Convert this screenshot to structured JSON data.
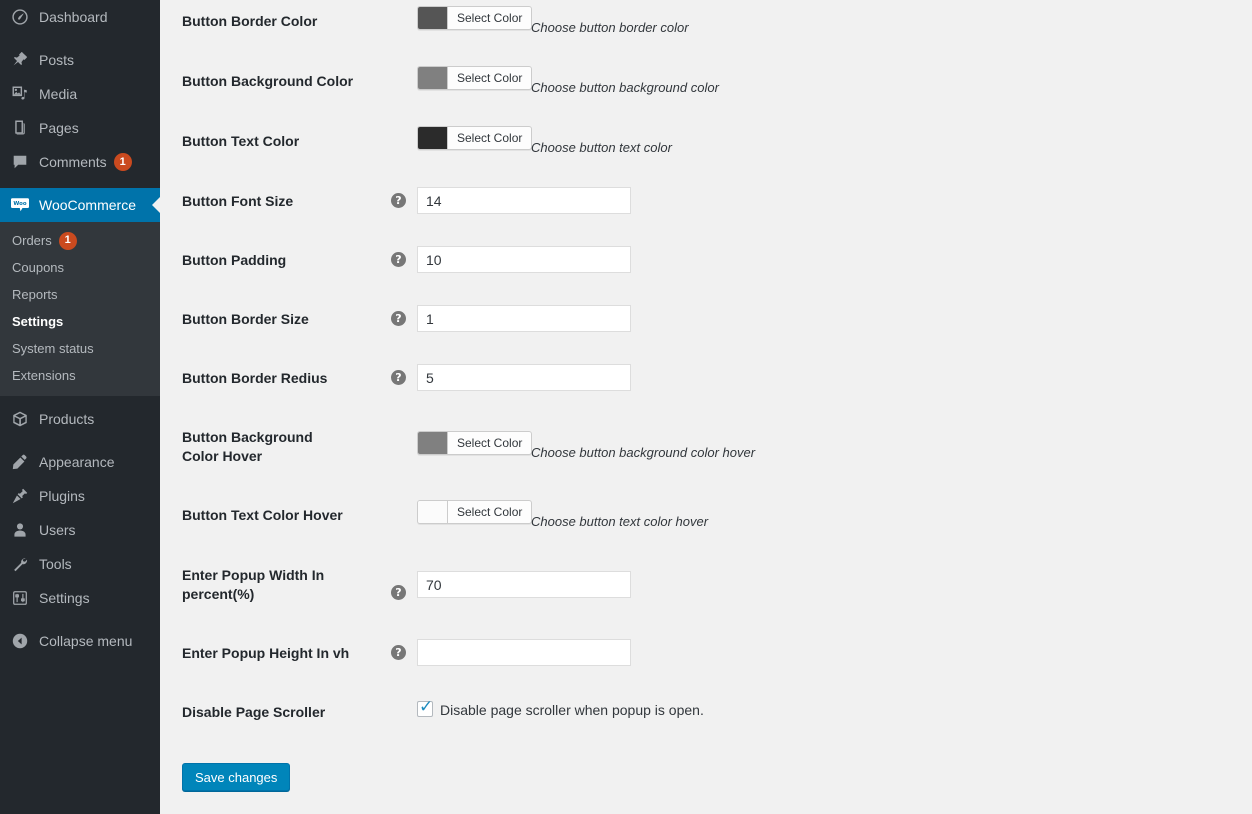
{
  "sidebar": {
    "items": [
      {
        "label": "Dashboard",
        "icon": "dashboard-icon",
        "gap_before": false
      },
      {
        "label": "Posts",
        "icon": "pin-icon",
        "gap_before": true
      },
      {
        "label": "Media",
        "icon": "media-icon",
        "gap_before": false
      },
      {
        "label": "Pages",
        "icon": "pages-icon",
        "gap_before": false
      },
      {
        "label": "Comments",
        "icon": "comment-icon",
        "badge": "1",
        "gap_before": false
      },
      {
        "label": "WooCommerce",
        "icon": "woo-icon",
        "current": true,
        "gap_before": true
      },
      {
        "label": "Products",
        "icon": "products-icon",
        "gap_before": false
      },
      {
        "label": "Appearance",
        "icon": "appearance-icon",
        "gap_before": true
      },
      {
        "label": "Plugins",
        "icon": "plugins-icon",
        "gap_before": false
      },
      {
        "label": "Users",
        "icon": "users-icon",
        "gap_before": false
      },
      {
        "label": "Tools",
        "icon": "tools-icon",
        "gap_before": false
      },
      {
        "label": "Settings",
        "icon": "settings-icon",
        "gap_before": false
      },
      {
        "label": "Collapse menu",
        "icon": "collapse-icon",
        "gap_before": true
      }
    ],
    "submenu": [
      {
        "label": "Orders",
        "badge": "1"
      },
      {
        "label": "Coupons"
      },
      {
        "label": "Reports"
      },
      {
        "label": "Settings",
        "current": true
      },
      {
        "label": "System status"
      },
      {
        "label": "Extensions"
      }
    ],
    "colors": {
      "background": "#23282d",
      "submenu_background": "#32373c",
      "current_background": "#0073aa",
      "badge": "#ca4a1f",
      "text": "#b4b9be"
    }
  },
  "settings": {
    "select_color_label": "Select Color",
    "rows": [
      {
        "label": "Button Border Color",
        "type": "color",
        "swatch": "#555555",
        "description": "Choose button border color"
      },
      {
        "label": "Button Background Color",
        "type": "color",
        "swatch": "#808080",
        "description": "Choose button background color"
      },
      {
        "label": "Button Text Color",
        "type": "color",
        "swatch": "#2b2b2b",
        "description": "Choose button text color"
      },
      {
        "label": "Button Font Size",
        "type": "text",
        "value": "14",
        "help": "?"
      },
      {
        "label": "Button Padding",
        "type": "text",
        "value": "10",
        "help": "?"
      },
      {
        "label": "Button Border Size",
        "type": "text",
        "value": "1",
        "help": "?"
      },
      {
        "label": "Button Border Redius",
        "type": "text",
        "value": "5",
        "help": "?"
      },
      {
        "label": "Button Background Color Hover",
        "type": "color",
        "swatch": "#808080",
        "description": "Choose button background color hover"
      },
      {
        "label": "Button Text Color Hover",
        "type": "color",
        "swatch": "#fbfbfb",
        "description": "Choose button text color hover"
      },
      {
        "label": "Enter Popup Width In percent(%)",
        "type": "text",
        "value": "70",
        "help": "?"
      },
      {
        "label": "Enter Popup Height In vh",
        "type": "text",
        "value": "",
        "help": "?"
      },
      {
        "label": "Disable Page Scroller",
        "type": "checkbox",
        "checked": true,
        "checkbox_label": "Disable page scroller when popup is open."
      }
    ],
    "save_label": "Save changes"
  }
}
